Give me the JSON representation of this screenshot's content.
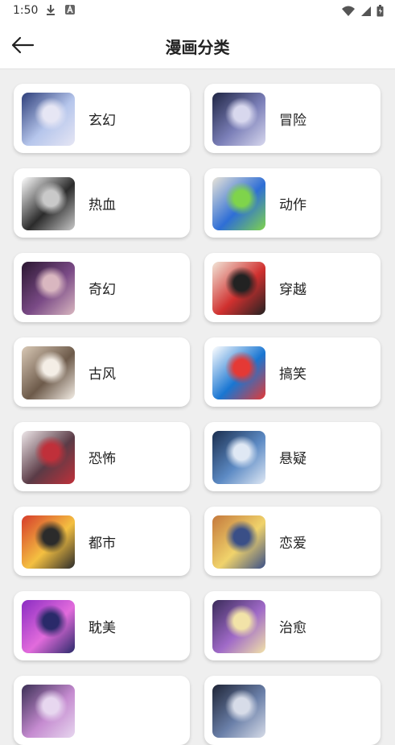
{
  "status": {
    "time": "1:50"
  },
  "appbar": {
    "title": "漫画分类"
  },
  "categories": [
    {
      "label": "玄幻",
      "colors": [
        "#2d3e7a",
        "#b6c6ec",
        "#e6e6f4"
      ]
    },
    {
      "label": "冒险",
      "colors": [
        "#1f2544",
        "#7b7fb8",
        "#d8d8ee"
      ]
    },
    {
      "label": "热血",
      "colors": [
        "#ffffff",
        "#2b2b2b",
        "#c9c9c9"
      ]
    },
    {
      "label": "动作",
      "colors": [
        "#e9e4d8",
        "#2e6ed6",
        "#7fd44b"
      ]
    },
    {
      "label": "奇幻",
      "colors": [
        "#2a1630",
        "#7a4a86",
        "#d9b7c0"
      ]
    },
    {
      "label": "穿越",
      "colors": [
        "#f2e6d8",
        "#d0302f",
        "#222222"
      ]
    },
    {
      "label": "古风",
      "colors": [
        "#d9c9b6",
        "#6d5a4a",
        "#f4eee6"
      ]
    },
    {
      "label": "搞笑",
      "colors": [
        "#ffffff",
        "#1976d2",
        "#e53935"
      ]
    },
    {
      "label": "恐怖",
      "colors": [
        "#efe8ea",
        "#5a3b46",
        "#c0303a"
      ]
    },
    {
      "label": "悬疑",
      "colors": [
        "#1a2e4f",
        "#5c8ac4",
        "#dfe8f4"
      ]
    },
    {
      "label": "都市",
      "colors": [
        "#d63b2b",
        "#f4c041",
        "#2b2b2b"
      ]
    },
    {
      "label": "恋爱",
      "colors": [
        "#c4783c",
        "#f0d36b",
        "#3a4f87"
      ]
    },
    {
      "label": "耽美",
      "colors": [
        "#8a2cc2",
        "#e26bdc",
        "#2a2a6a"
      ]
    },
    {
      "label": "治愈",
      "colors": [
        "#3a2b5a",
        "#a06ac8",
        "#f2e3a8"
      ]
    },
    {
      "label": "",
      "colors": [
        "#3b2f55",
        "#c58bd0",
        "#e7d7ef"
      ]
    },
    {
      "label": "",
      "colors": [
        "#1e2436",
        "#6a7fa8",
        "#d7dce8"
      ]
    }
  ]
}
